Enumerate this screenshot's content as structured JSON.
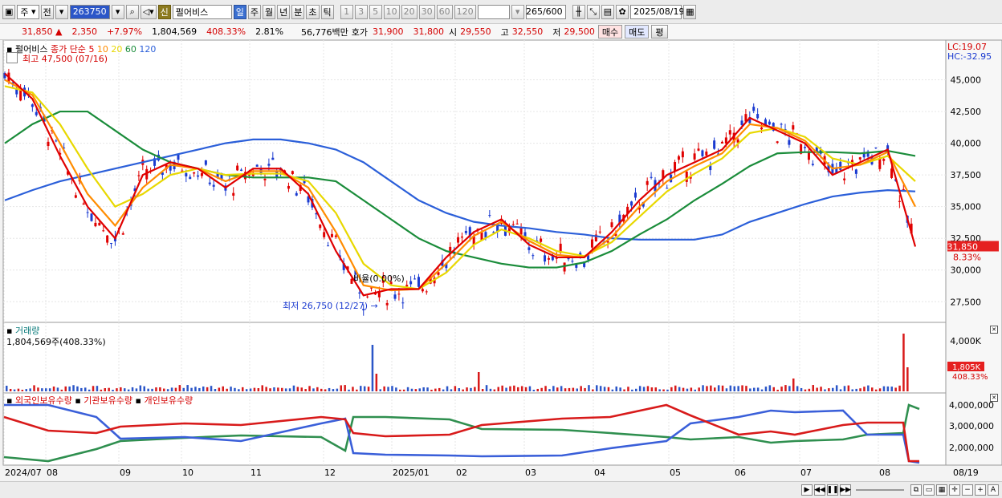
{
  "toolbar": {
    "period_label": "주",
    "prev_label": "전",
    "stock_code": "263750",
    "stock_name": "펄어비스",
    "sin_label": "신",
    "periods": [
      "일",
      "주",
      "월",
      "년",
      "분",
      "초",
      "틱"
    ],
    "active_period": "일",
    "intervals": [
      "1",
      "3",
      "5",
      "10",
      "20",
      "30",
      "60",
      "120"
    ],
    "count": "265",
    "count_total": "/600",
    "date": "2025/08/19"
  },
  "quote": {
    "price": "31,850",
    "change_arrow": "▲",
    "change": "2,350",
    "change_pct": "+7.97%",
    "volume": "1,804,569",
    "volume_ratio": "408.33%",
    "turnover": "2.81%",
    "amount": "56,776백만",
    "hoga_label": "호가",
    "ask": "31,900",
    "bid": "31,800",
    "open_label": "시",
    "open": "29,550",
    "high_label": "고",
    "high": "32,550",
    "low_label": "저",
    "low": "29,500",
    "buy_label": "매수",
    "sell_label": "매도",
    "avg_label": "평"
  },
  "panes": {
    "price": {
      "title": "펄어비스",
      "ma_label": "종가 단순",
      "ma_periods": [
        {
          "label": "5",
          "color": "#e00000"
        },
        {
          "label": "10",
          "color": "#ff8c00"
        },
        {
          "label": "20",
          "color": "#e8d800"
        },
        {
          "label": "60",
          "color": "#1a8c3a"
        },
        {
          "label": "120",
          "color": "#2b5fd9"
        }
      ],
      "high_note": "최고 47,500 (07/16)",
      "low_note": "최저 26,750 (12/27)",
      "ratio_note": "비율(0.00%)",
      "lc": "LC:19.07",
      "hc": "HC:-32.95",
      "current_tag": "31,850",
      "current_pct": "8.33%"
    },
    "volume": {
      "title": "거래량",
      "value": "1,804,569주(408.33%)",
      "current_tag": "1,805K",
      "current_pct": "408.33%"
    },
    "holdings": {
      "foreign_label": "외국인보유수량",
      "inst_label": "기관보유수량",
      "indiv_label": "개인보유수량"
    }
  },
  "chart_data": {
    "type": "line",
    "title": "펄어비스",
    "y_ticks": [
      "45,000",
      "42,500",
      "40,000",
      "37,500",
      "35,000",
      "32,500",
      "30,000",
      "27,500"
    ],
    "volume_ticks": [
      "4,000K"
    ],
    "holding_ticks": [
      "4,000,000",
      "3,000,000",
      "2,000,000"
    ],
    "x_labels": [
      "2024/07",
      "08",
      "09",
      "10",
      "11",
      "12",
      "2025/01",
      "02",
      "03",
      "04",
      "05",
      "06",
      "07",
      "08",
      "08/19"
    ],
    "ylim": [
      26000,
      47500
    ],
    "series": [
      {
        "name": "5",
        "color": "#e00000",
        "values": [
          45500,
          43500,
          39000,
          35000,
          32500,
          37500,
          38500,
          38000,
          36500,
          38000,
          38000,
          36000,
          31500,
          28000,
          28500,
          28500,
          31000,
          33000,
          34000,
          32000,
          31000,
          31000,
          33000,
          35500,
          37500,
          38500,
          39500,
          42000,
          41000,
          40000,
          37500,
          38500,
          39500,
          31850
        ]
      },
      {
        "name": "10",
        "color": "#ff8c00",
        "values": [
          45000,
          43800,
          40000,
          36000,
          33500,
          36500,
          38300,
          38000,
          37000,
          37800,
          37800,
          36500,
          33000,
          28800,
          28400,
          28500,
          30500,
          32700,
          33800,
          32300,
          31200,
          31000,
          32600,
          35000,
          37000,
          38200,
          39200,
          41500,
          41200,
          40200,
          38000,
          38300,
          39300,
          35000
        ]
      },
      {
        "name": "20",
        "color": "#e8d800",
        "values": [
          44500,
          44000,
          41500,
          38000,
          35000,
          36000,
          37500,
          38000,
          37500,
          37600,
          37600,
          37000,
          34500,
          30500,
          28800,
          28500,
          29800,
          32000,
          33200,
          32500,
          31500,
          31100,
          32200,
          34200,
          36200,
          37600,
          38800,
          40800,
          41200,
          40500,
          38800,
          38300,
          39000,
          37000
        ]
      },
      {
        "name": "60",
        "color": "#1a8c3a",
        "values": [
          40000,
          41500,
          42500,
          42500,
          41000,
          39500,
          38500,
          38000,
          37500,
          37300,
          37300,
          37300,
          37000,
          35500,
          34000,
          32500,
          31500,
          31000,
          30500,
          30200,
          30200,
          30600,
          31500,
          32800,
          34000,
          35500,
          36800,
          38200,
          39200,
          39300,
          39300,
          39200,
          39400,
          39000
        ]
      },
      {
        "name": "120",
        "color": "#2b5fd9",
        "values": [
          35500,
          36300,
          37000,
          37500,
          38000,
          38500,
          39000,
          39500,
          40000,
          40300,
          40300,
          40000,
          39500,
          38500,
          37000,
          35500,
          34500,
          33800,
          33500,
          33300,
          33000,
          32800,
          32500,
          32400,
          32400,
          32400,
          32800,
          33800,
          34500,
          35200,
          35800,
          36100,
          36300,
          36200
        ]
      }
    ],
    "holdings_series": [
      {
        "name": "외국인보유수량",
        "color": "#d81a1a"
      },
      {
        "name": "기관보유수량",
        "color": "#3a5fd9"
      },
      {
        "name": "개인보유수량",
        "color": "#2f8f4f"
      }
    ]
  }
}
